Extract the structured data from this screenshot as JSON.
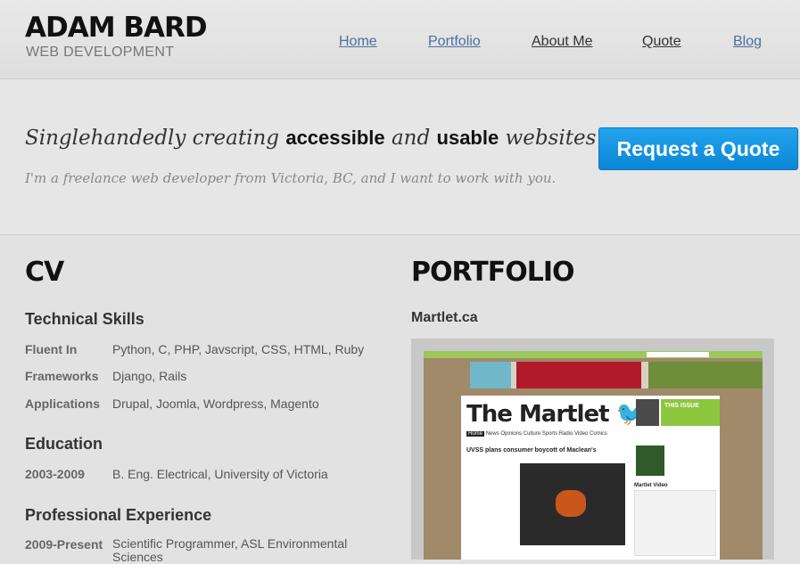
{
  "header": {
    "logo_title": "ADAM BARD",
    "logo_subtitle": "WEB DEVELOPMENT",
    "nav": [
      {
        "label": "Home",
        "color": "#4d6fa0"
      },
      {
        "label": "Portfolio",
        "color": "#4d6fa0"
      },
      {
        "label": "About Me",
        "color": "#333333"
      },
      {
        "label": "Quote",
        "color": "#333333"
      },
      {
        "label": "Blog",
        "color": "#4d6fa0"
      }
    ]
  },
  "hero": {
    "tagline_1": "Singlehandedly creating",
    "tagline_accessible": "accessible",
    "tagline_and": "and",
    "tagline_usable": "usable",
    "tagline_websites": "websites",
    "subtitle": "I'm a freelance web developer from Victoria, BC, and I want to work with you.",
    "cta_label": "Request a Quote",
    "cta_color": "#1a97e4"
  },
  "cv": {
    "heading": "CV",
    "technical": {
      "title": "Technical Skills",
      "rows": [
        {
          "label": "Fluent In",
          "value": "Python, C, PHP, Javscript, CSS, HTML, Ruby"
        },
        {
          "label": "Frameworks",
          "value": "Django, Rails"
        },
        {
          "label": "Applications",
          "value": "Drupal, Joomla, Wordpress, Magento"
        }
      ]
    },
    "education": {
      "title": "Education",
      "rows": [
        {
          "label": "2003-2009",
          "value": "B. Eng. Electrical, University of Victoria"
        }
      ]
    },
    "experience": {
      "title": "Professional Experience",
      "rows": [
        {
          "label": "2009-Present",
          "value": "Scientific Programmer, ASL Environmental Sciences"
        }
      ]
    }
  },
  "portfolio": {
    "heading": "PORTFOLIO",
    "project_title": "Martlet.ca",
    "screenshot": {
      "site_name": "The Martlet",
      "issue_label": "THIS ISSUE",
      "nav_items": [
        "Home",
        "News",
        "Opinions",
        "Culture",
        "Sports",
        "Radio",
        "Video",
        "Comics"
      ],
      "headline": "UVSS plans consumer boycott of Maclean's",
      "side_label": "Martlet Video"
    }
  }
}
